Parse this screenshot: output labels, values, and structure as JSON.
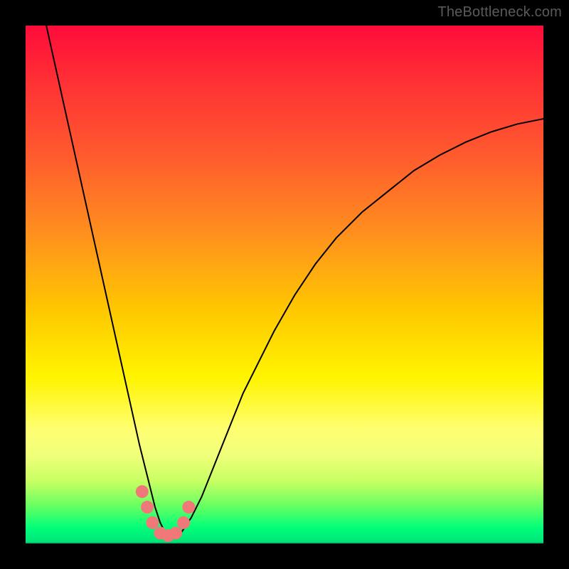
{
  "watermark": "TheBottleneck.com",
  "colors": {
    "background": "#000000",
    "gradient_top": "#ff0b3a",
    "gradient_mid": "#fff400",
    "gradient_bottom": "#00e27a",
    "curve": "#000000",
    "markers": "#f07878"
  },
  "chart_data": {
    "type": "line",
    "title": "",
    "xlabel": "",
    "ylabel": "",
    "xlim": [
      0,
      100
    ],
    "ylim": [
      0,
      100
    ],
    "grid": false,
    "legend": false,
    "series": [
      {
        "name": "bottleneck-curve",
        "x": [
          4,
          6,
          8,
          10,
          12,
          14,
          16,
          18,
          20,
          22,
          23,
          24,
          25,
          26,
          27,
          28,
          29,
          30,
          32,
          34,
          36,
          38,
          40,
          42,
          45,
          48,
          52,
          56,
          60,
          65,
          70,
          75,
          80,
          85,
          90,
          95,
          100
        ],
        "y": [
          100,
          91,
          82,
          73,
          64,
          55,
          46,
          37,
          28,
          19,
          15,
          11,
          7,
          4,
          2,
          1,
          1,
          2,
          5,
          9,
          14,
          19,
          24,
          29,
          35,
          41,
          48,
          54,
          59,
          64,
          68,
          72,
          75,
          77.5,
          79.5,
          81,
          82
        ]
      }
    ],
    "markers": {
      "name": "highlight-dots",
      "x": [
        22.5,
        23.5,
        24.5,
        26,
        27.5,
        29,
        30.5,
        31.5
      ],
      "y": [
        10,
        7,
        4,
        2,
        1.5,
        2,
        4,
        7
      ]
    }
  }
}
